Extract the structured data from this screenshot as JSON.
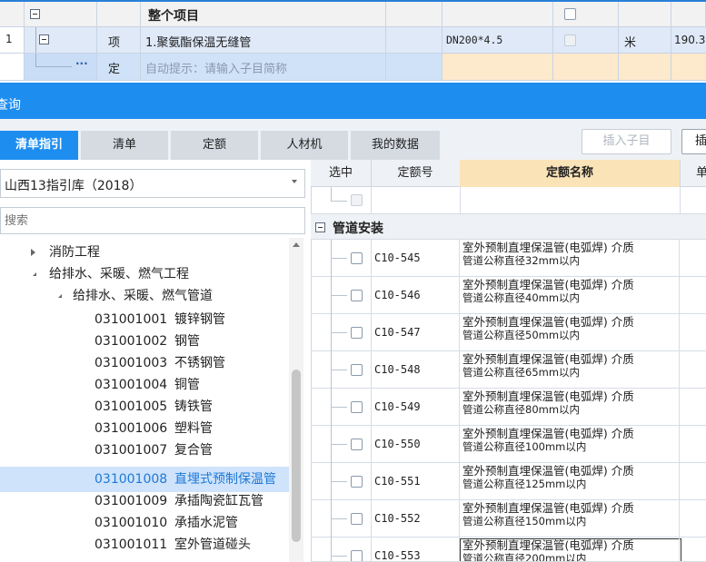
{
  "top_grid": {
    "header_title": "整个项目",
    "row1": {
      "index": "1",
      "type": "项",
      "name": "1.聚氨酯保温无缝管",
      "spec": "DN200*4.5",
      "unit": "米",
      "qty": "190.3"
    },
    "row2": {
      "dots": "···",
      "type": "定",
      "hint": "自动提示：请输入子目简称"
    }
  },
  "query_panel": {
    "title": "查询",
    "tabs": [
      "清单指引",
      "清单",
      "定额",
      "人材机",
      "我的数据"
    ],
    "insert_child_button": "插入子目",
    "insert_button": "插",
    "library": {
      "selected": "山西13指引库（2018）"
    },
    "search": {
      "placeholder": "搜索"
    },
    "tree": {
      "level1": [
        "消防工程",
        "给排水、采暖、燃气工程"
      ],
      "level2": "给排水、采暖、燃气管道",
      "items": [
        {
          "code": "031001001",
          "name": "镀锌钢管"
        },
        {
          "code": "031001002",
          "name": "钢管"
        },
        {
          "code": "031001003",
          "name": "不锈钢管"
        },
        {
          "code": "031001004",
          "name": "铜管"
        },
        {
          "code": "031001005",
          "name": "铸铁管"
        },
        {
          "code": "031001006",
          "name": "塑料管"
        },
        {
          "code": "031001007",
          "name": "复合管"
        },
        {
          "code": "031001008",
          "name": "直埋式预制保温管"
        },
        {
          "code": "031001009",
          "name": "承插陶瓷缸瓦管"
        },
        {
          "code": "031001010",
          "name": "承插水泥管"
        },
        {
          "code": "031001011",
          "name": "室外管道碰头"
        }
      ],
      "selected_index": 7
    },
    "result_table": {
      "headers": [
        "选中",
        "定额号",
        "定额名称",
        "单"
      ],
      "group": "管道安装",
      "rows": [
        {
          "code": "C10-545",
          "name1": "室外预制直埋保温管(电弧焊) 介质",
          "name2": "管道公称直径32mm以内"
        },
        {
          "code": "C10-546",
          "name1": "室外预制直埋保温管(电弧焊) 介质",
          "name2": "管道公称直径40mm以内"
        },
        {
          "code": "C10-547",
          "name1": "室外预制直埋保温管(电弧焊) 介质",
          "name2": "管道公称直径50mm以内"
        },
        {
          "code": "C10-548",
          "name1": "室外预制直埋保温管(电弧焊) 介质",
          "name2": "管道公称直径65mm以内"
        },
        {
          "code": "C10-549",
          "name1": "室外预制直埋保温管(电弧焊) 介质",
          "name2": "管道公称直径80mm以内"
        },
        {
          "code": "C10-550",
          "name1": "室外预制直埋保温管(电弧焊) 介质",
          "name2": "管道公称直径100mm以内"
        },
        {
          "code": "C10-551",
          "name1": "室外预制直埋保温管(电弧焊) 介质",
          "name2": "管道公称直径125mm以内"
        },
        {
          "code": "C10-552",
          "name1": "室外预制直埋保温管(电弧焊) 介质",
          "name2": "管道公称直径150mm以内"
        },
        {
          "code": "C10-553",
          "name1": "室外预制直埋保温管(电弧焊) 介质",
          "name2": "管道公称直径200mm以内"
        }
      ]
    }
  },
  "colors": {
    "accent_blue": "#1e8df0",
    "header_orange": "#fbe3b8",
    "selected_row": "#cfe3fb",
    "group_bg": "#eef1f5"
  }
}
